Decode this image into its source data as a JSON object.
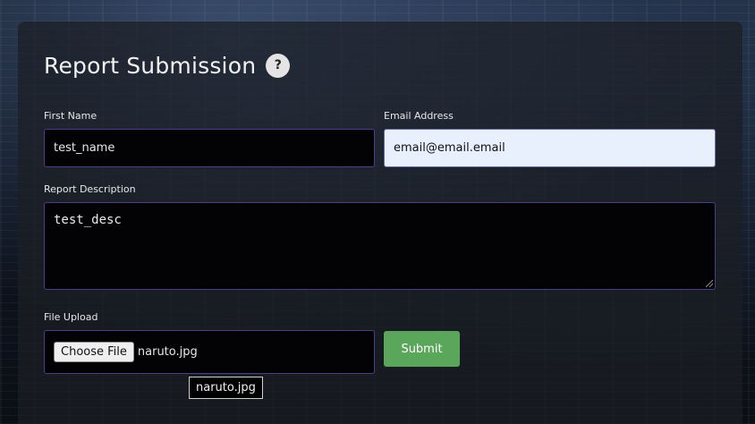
{
  "form": {
    "title": "Report Submission",
    "help_icon": "?",
    "first_name": {
      "label": "First Name",
      "value": "test_name"
    },
    "email": {
      "label": "Email Address",
      "value": "email@email.email"
    },
    "description": {
      "label": "Report Description",
      "value": "test_desc"
    },
    "file_upload": {
      "label": "File Upload",
      "button_label": "Choose File",
      "file_name": "naruto.jpg",
      "tooltip": "naruto.jpg"
    },
    "submit_label": "Submit"
  },
  "colors": {
    "submit": "#5aa65a",
    "input_border": "#4b3d86",
    "autofill_bg": "#e8f0fe"
  },
  "icons": {
    "help": "question-mark-circle-icon"
  }
}
